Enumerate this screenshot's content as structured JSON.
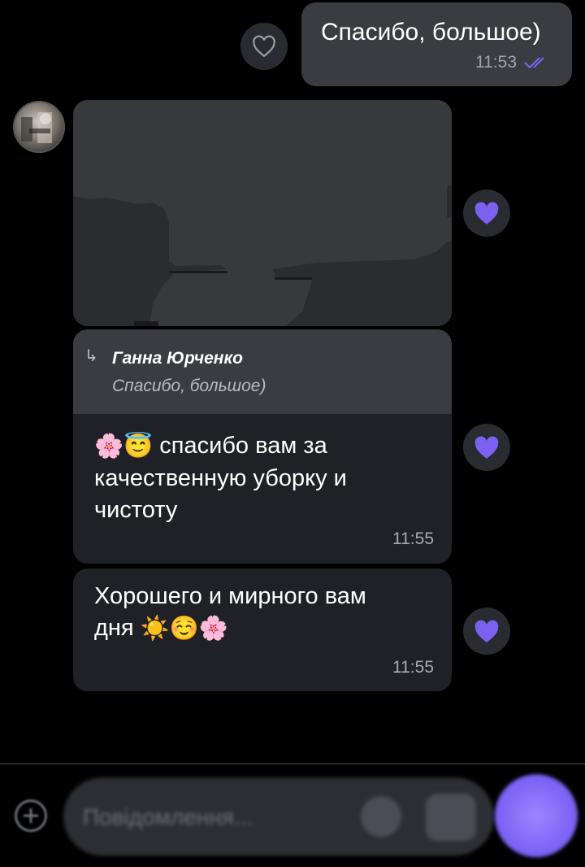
{
  "outgoing_message": {
    "text": "Спасибо, большое)",
    "time": "11:53",
    "status_icon": "double-check-icon"
  },
  "image_message": {
    "image_desc": "dark-image-placeholder",
    "reaction_icon": "heart-filled-icon"
  },
  "reply_message": {
    "quote_author": "Ганна Юрченко",
    "quote_text": "Спасибо, большое)",
    "emojis": [
      "🌸",
      "😇"
    ],
    "text_line1": "спасибо вам за",
    "text_line2": "качественную уборку и",
    "text_line3": "чистоту",
    "time": "11:55"
  },
  "third_message": {
    "text_line1": "Хорошего и мирного вам",
    "text_line2": "дня",
    "emojis": [
      "☀️",
      "☺️",
      "🌸"
    ],
    "time": "11:55"
  },
  "composer": {
    "placeholder": "Повідомлення..."
  },
  "colors": {
    "accent": "#7b61f0",
    "bubble_out": "#3a3c42",
    "bubble_in": "#1f2126",
    "background": "#000000"
  }
}
